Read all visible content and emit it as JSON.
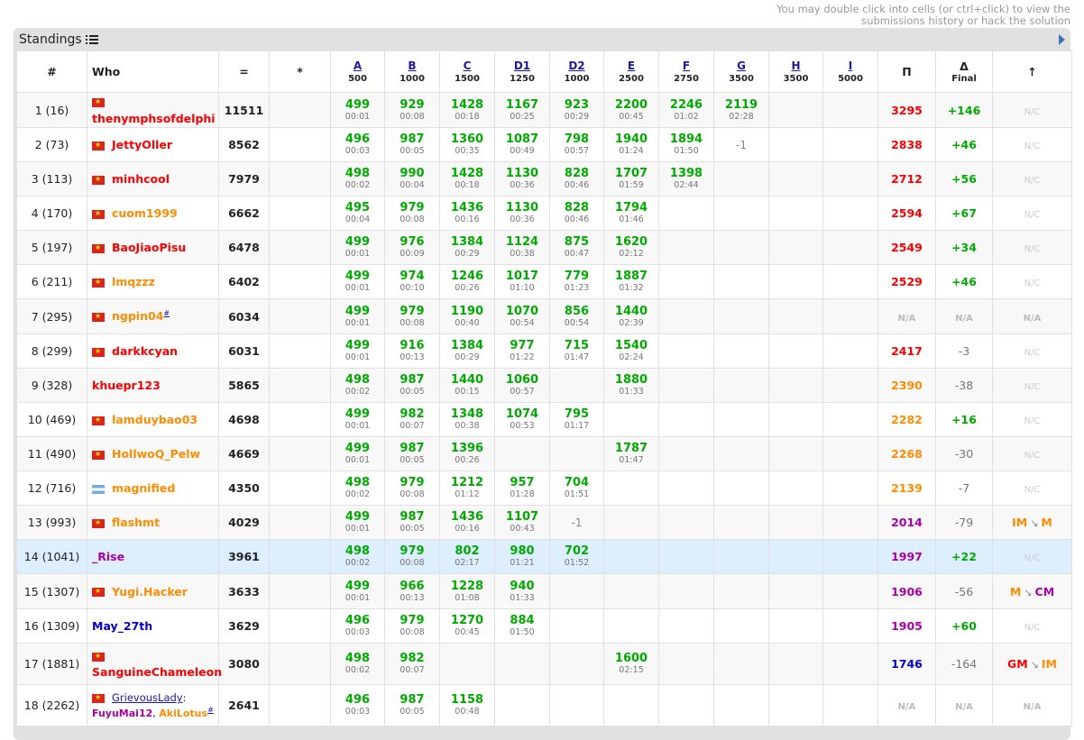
{
  "hint": {
    "line1": "You may double click into cells (or ctrl+click) to view the",
    "line2": "submissions history or hack the solution"
  },
  "title": "Standings",
  "headers": {
    "rank": "#",
    "who": "Who",
    "score": "=",
    "hacks": "*",
    "pi": "Π",
    "delta": "Δ",
    "delta_sub": "Final",
    "change": "↑"
  },
  "problems": [
    {
      "name": "A",
      "points": "500"
    },
    {
      "name": "B",
      "points": "1000"
    },
    {
      "name": "C",
      "points": "1500"
    },
    {
      "name": "D1",
      "points": "1250"
    },
    {
      "name": "D2",
      "points": "1000"
    },
    {
      "name": "E",
      "points": "2500"
    },
    {
      "name": "F",
      "points": "2750"
    },
    {
      "name": "G",
      "points": "3500"
    },
    {
      "name": "H",
      "points": "3500"
    },
    {
      "name": "I",
      "points": "5000"
    }
  ],
  "rows": [
    {
      "rank": "1 (16)",
      "who": "thenymphsofdelphi",
      "color": "red",
      "flag": "vn",
      "flagblock": true,
      "score": "11511",
      "pi": "3295",
      "picolor": "red",
      "pifirst": "3",
      "delta": "+146",
      "dsign": "pos",
      "change": "N/C",
      "cells": [
        [
          "499",
          "00:01"
        ],
        [
          "929",
          "00:08"
        ],
        [
          "1428",
          "00:18"
        ],
        [
          "1167",
          "00:25"
        ],
        [
          "923",
          "00:29"
        ],
        [
          "2200",
          "00:45"
        ],
        [
          "2246",
          "01:02"
        ],
        [
          "2119",
          "02:28"
        ],
        [
          "",
          ""
        ],
        [
          "",
          ""
        ]
      ]
    },
    {
      "rank": "2 (73)",
      "who": "JettyOller",
      "color": "red",
      "flag": "vn",
      "score": "8562",
      "pi": "2838",
      "picolor": "red",
      "delta": "+46",
      "dsign": "pos",
      "change": "N/C",
      "cells": [
        [
          "496",
          "00:03"
        ],
        [
          "987",
          "00:05"
        ],
        [
          "1360",
          "00:35"
        ],
        [
          "1087",
          "00:49"
        ],
        [
          "798",
          "00:57"
        ],
        [
          "1940",
          "01:24"
        ],
        [
          "1894",
          "01:50"
        ],
        [
          "-1",
          ""
        ],
        [
          "",
          ""
        ],
        [
          "",
          ""
        ]
      ]
    },
    {
      "rank": "3 (113)",
      "who": "minhcool",
      "color": "red",
      "flag": "vn",
      "score": "7979",
      "pi": "2712",
      "picolor": "red",
      "delta": "+56",
      "dsign": "pos",
      "change": "N/C",
      "cells": [
        [
          "498",
          "00:02"
        ],
        [
          "990",
          "00:04"
        ],
        [
          "1428",
          "00:18"
        ],
        [
          "1130",
          "00:36"
        ],
        [
          "828",
          "00:46"
        ],
        [
          "1707",
          "01:59"
        ],
        [
          "1398",
          "02:44"
        ],
        [
          "",
          ""
        ],
        [
          "",
          ""
        ],
        [
          "",
          ""
        ]
      ]
    },
    {
      "rank": "4 (170)",
      "who": "cuom1999",
      "color": "orange",
      "flag": "vn",
      "score": "6662",
      "pi": "2594",
      "picolor": "red",
      "delta": "+67",
      "dsign": "pos",
      "change": "N/C",
      "cells": [
        [
          "495",
          "00:04"
        ],
        [
          "979",
          "00:08"
        ],
        [
          "1436",
          "00:16"
        ],
        [
          "1130",
          "00:36"
        ],
        [
          "828",
          "00:46"
        ],
        [
          "1794",
          "01:46"
        ],
        [
          "",
          ""
        ],
        [
          "",
          ""
        ],
        [
          "",
          ""
        ],
        [
          "",
          ""
        ]
      ]
    },
    {
      "rank": "5 (197)",
      "who": "BaoJiaoPisu",
      "color": "red",
      "flag": "vn",
      "score": "6478",
      "pi": "2549",
      "picolor": "red",
      "delta": "+34",
      "dsign": "pos",
      "change": "N/C",
      "cells": [
        [
          "499",
          "00:01"
        ],
        [
          "976",
          "00:09"
        ],
        [
          "1384",
          "00:29"
        ],
        [
          "1124",
          "00:38"
        ],
        [
          "875",
          "00:47"
        ],
        [
          "1620",
          "02:12"
        ],
        [
          "",
          ""
        ],
        [
          "",
          ""
        ],
        [
          "",
          ""
        ],
        [
          "",
          ""
        ]
      ]
    },
    {
      "rank": "6 (211)",
      "who": "lmqzzz",
      "color": "orange",
      "flag": "vn",
      "score": "6402",
      "pi": "2529",
      "picolor": "red",
      "delta": "+46",
      "dsign": "pos",
      "change": "N/C",
      "cells": [
        [
          "499",
          "00:01"
        ],
        [
          "974",
          "00:10"
        ],
        [
          "1246",
          "00:26"
        ],
        [
          "1017",
          "01:10"
        ],
        [
          "779",
          "01:23"
        ],
        [
          "1887",
          "01:32"
        ],
        [
          "",
          ""
        ],
        [
          "",
          ""
        ],
        [
          "",
          ""
        ],
        [
          "",
          ""
        ]
      ]
    },
    {
      "rank": "7 (295)",
      "who": "ngpin04",
      "color": "orange",
      "flag": "vn",
      "sup": "#",
      "score": "6034",
      "pi": "N/A",
      "picolor": "na",
      "delta": "N/A",
      "dsign": "na",
      "change": "N/A",
      "cells": [
        [
          "499",
          "00:01"
        ],
        [
          "979",
          "00:08"
        ],
        [
          "1190",
          "00:40"
        ],
        [
          "1070",
          "00:54"
        ],
        [
          "856",
          "00:54"
        ],
        [
          "1440",
          "02:39"
        ],
        [
          "",
          ""
        ],
        [
          "",
          ""
        ],
        [
          "",
          ""
        ],
        [
          "",
          ""
        ]
      ]
    },
    {
      "rank": "8 (299)",
      "who": "darkkcyan",
      "color": "red",
      "flag": "vn",
      "score": "6031",
      "pi": "2417",
      "picolor": "red",
      "delta": "-3",
      "dsign": "neg",
      "change": "N/C",
      "cells": [
        [
          "499",
          "00:01"
        ],
        [
          "916",
          "00:13"
        ],
        [
          "1384",
          "00:29"
        ],
        [
          "977",
          "01:22"
        ],
        [
          "715",
          "01:47"
        ],
        [
          "1540",
          "02:24"
        ],
        [
          "",
          ""
        ],
        [
          "",
          ""
        ],
        [
          "",
          ""
        ],
        [
          "",
          ""
        ]
      ]
    },
    {
      "rank": "9 (328)",
      "who": "khuepr123",
      "color": "red",
      "flag": "",
      "score": "5865",
      "pi": "2390",
      "picolor": "orange",
      "delta": "-38",
      "dsign": "neg",
      "change": "N/C",
      "cells": [
        [
          "498",
          "00:02"
        ],
        [
          "987",
          "00:05"
        ],
        [
          "1440",
          "00:15"
        ],
        [
          "1060",
          "00:57"
        ],
        [
          "",
          ""
        ],
        [
          "1880",
          "01:33"
        ],
        [
          "",
          ""
        ],
        [
          "",
          ""
        ],
        [
          "",
          ""
        ],
        [
          "",
          ""
        ]
      ]
    },
    {
      "rank": "10 (469)",
      "who": "lamduybao03",
      "color": "orange",
      "flag": "vn",
      "score": "4698",
      "pi": "2282",
      "picolor": "orange",
      "delta": "+16",
      "dsign": "pos",
      "change": "N/C",
      "cells": [
        [
          "499",
          "00:01"
        ],
        [
          "982",
          "00:07"
        ],
        [
          "1348",
          "00:38"
        ],
        [
          "1074",
          "00:53"
        ],
        [
          "795",
          "01:17"
        ],
        [
          "",
          ""
        ],
        [
          "",
          ""
        ],
        [
          "",
          ""
        ],
        [
          "",
          ""
        ],
        [
          "",
          ""
        ]
      ]
    },
    {
      "rank": "11 (490)",
      "who": "HollwoQ_Pelw",
      "color": "orange",
      "flag": "vn",
      "score": "4669",
      "pi": "2268",
      "picolor": "orange",
      "delta": "-30",
      "dsign": "neg",
      "change": "N/C",
      "cells": [
        [
          "499",
          "00:01"
        ],
        [
          "987",
          "00:05"
        ],
        [
          "1396",
          "00:26"
        ],
        [
          "",
          ""
        ],
        [
          "",
          ""
        ],
        [
          "1787",
          "01:47"
        ],
        [
          "",
          ""
        ],
        [
          "",
          ""
        ],
        [
          "",
          ""
        ],
        [
          "",
          ""
        ]
      ]
    },
    {
      "rank": "12 (716)",
      "who": "magnified",
      "color": "orange",
      "flag": "ar",
      "score": "4350",
      "pi": "2139",
      "picolor": "orange",
      "delta": "-7",
      "dsign": "neg",
      "change": "N/C",
      "cells": [
        [
          "498",
          "00:02"
        ],
        [
          "979",
          "00:08"
        ],
        [
          "1212",
          "01:12"
        ],
        [
          "957",
          "01:28"
        ],
        [
          "704",
          "01:51"
        ],
        [
          "",
          ""
        ],
        [
          "",
          ""
        ],
        [
          "",
          ""
        ],
        [
          "",
          ""
        ],
        [
          "",
          ""
        ]
      ]
    },
    {
      "rank": "13 (993)",
      "who": "flashmt",
      "color": "orange",
      "flag": "vn",
      "score": "4029",
      "pi": "2014",
      "picolor": "violet",
      "delta": "-79",
      "dsign": "neg",
      "change": "IM ↘ M",
      "c1": "IM",
      "c1c": "orange",
      "c2": "M",
      "c2c": "orange",
      "cells": [
        [
          "499",
          "00:01"
        ],
        [
          "987",
          "00:05"
        ],
        [
          "1436",
          "00:16"
        ],
        [
          "1107",
          "00:43"
        ],
        [
          "-1",
          ""
        ],
        [
          "",
          ""
        ],
        [
          "",
          ""
        ],
        [
          "",
          ""
        ],
        [
          "",
          ""
        ],
        [
          "",
          ""
        ]
      ]
    },
    {
      "rank": "14 (1041)",
      "who": "_Rise",
      "color": "violet",
      "flag": "",
      "score": "3961",
      "pi": "1997",
      "picolor": "violet",
      "delta": "+22",
      "dsign": "pos",
      "change": "N/C",
      "hl": true,
      "cells": [
        [
          "498",
          "00:02"
        ],
        [
          "979",
          "00:08"
        ],
        [
          "802",
          "02:17"
        ],
        [
          "980",
          "01:21"
        ],
        [
          "702",
          "01:52"
        ],
        [
          "",
          ""
        ],
        [
          "",
          ""
        ],
        [
          "",
          ""
        ],
        [
          "",
          ""
        ],
        [
          "",
          ""
        ]
      ]
    },
    {
      "rank": "15 (1307)",
      "who": "Yugi.Hacker",
      "color": "orange",
      "flag": "vn",
      "score": "3633",
      "pi": "1906",
      "picolor": "violet",
      "delta": "-56",
      "dsign": "neg",
      "change": "M ↘ CM",
      "c1": "M",
      "c1c": "orange",
      "c2": "CM",
      "c2c": "violet",
      "cells": [
        [
          "499",
          "00:01"
        ],
        [
          "966",
          "00:13"
        ],
        [
          "1228",
          "01:08"
        ],
        [
          "940",
          "01:33"
        ],
        [
          "",
          ""
        ],
        [
          "",
          ""
        ],
        [
          "",
          ""
        ],
        [
          "",
          ""
        ],
        [
          "",
          ""
        ],
        [
          "",
          ""
        ]
      ]
    },
    {
      "rank": "16 (1309)",
      "who": "May_27th",
      "color": "blue",
      "flag": "",
      "score": "3629",
      "pi": "1905",
      "picolor": "violet",
      "delta": "+60",
      "dsign": "pos",
      "change": "N/C",
      "cells": [
        [
          "496",
          "00:03"
        ],
        [
          "979",
          "00:08"
        ],
        [
          "1270",
          "00:45"
        ],
        [
          "884",
          "01:50"
        ],
        [
          "",
          ""
        ],
        [
          "",
          ""
        ],
        [
          "",
          ""
        ],
        [
          "",
          ""
        ],
        [
          "",
          ""
        ],
        [
          "",
          ""
        ]
      ]
    },
    {
      "rank": "17 (1881)",
      "who": "SanguineChameleon",
      "color": "red",
      "flag": "vn",
      "flagblock": true,
      "score": "3080",
      "pi": "1746",
      "picolor": "blue",
      "delta": "-164",
      "dsign": "neg",
      "change": "GM ↘ IM",
      "c1": "GM",
      "c1c": "red",
      "c2": "IM",
      "c2c": "orange",
      "cells": [
        [
          "498",
          "00:02"
        ],
        [
          "982",
          "00:07"
        ],
        [
          "",
          ""
        ],
        [
          "",
          ""
        ],
        [
          "",
          ""
        ],
        [
          "1600",
          "02:15"
        ],
        [
          "",
          ""
        ],
        [
          "",
          ""
        ],
        [
          "",
          ""
        ],
        [
          "",
          ""
        ]
      ]
    },
    {
      "rank": "18 (2262)",
      "team": true,
      "teamname": "GrievousLady",
      "m1": "FuyuMai12",
      "m2": "AkiLotus",
      "flag": "vn",
      "score": "2641",
      "pi": "N/A",
      "picolor": "na",
      "delta": "N/A",
      "dsign": "na",
      "change": "N/A",
      "cells": [
        [
          "496",
          "00:03"
        ],
        [
          "987",
          "00:05"
        ],
        [
          "1158",
          "00:48"
        ],
        [
          "",
          ""
        ],
        [
          "",
          ""
        ],
        [
          "",
          ""
        ],
        [
          "",
          ""
        ],
        [
          "",
          ""
        ],
        [
          "",
          ""
        ],
        [
          "",
          ""
        ]
      ]
    }
  ]
}
